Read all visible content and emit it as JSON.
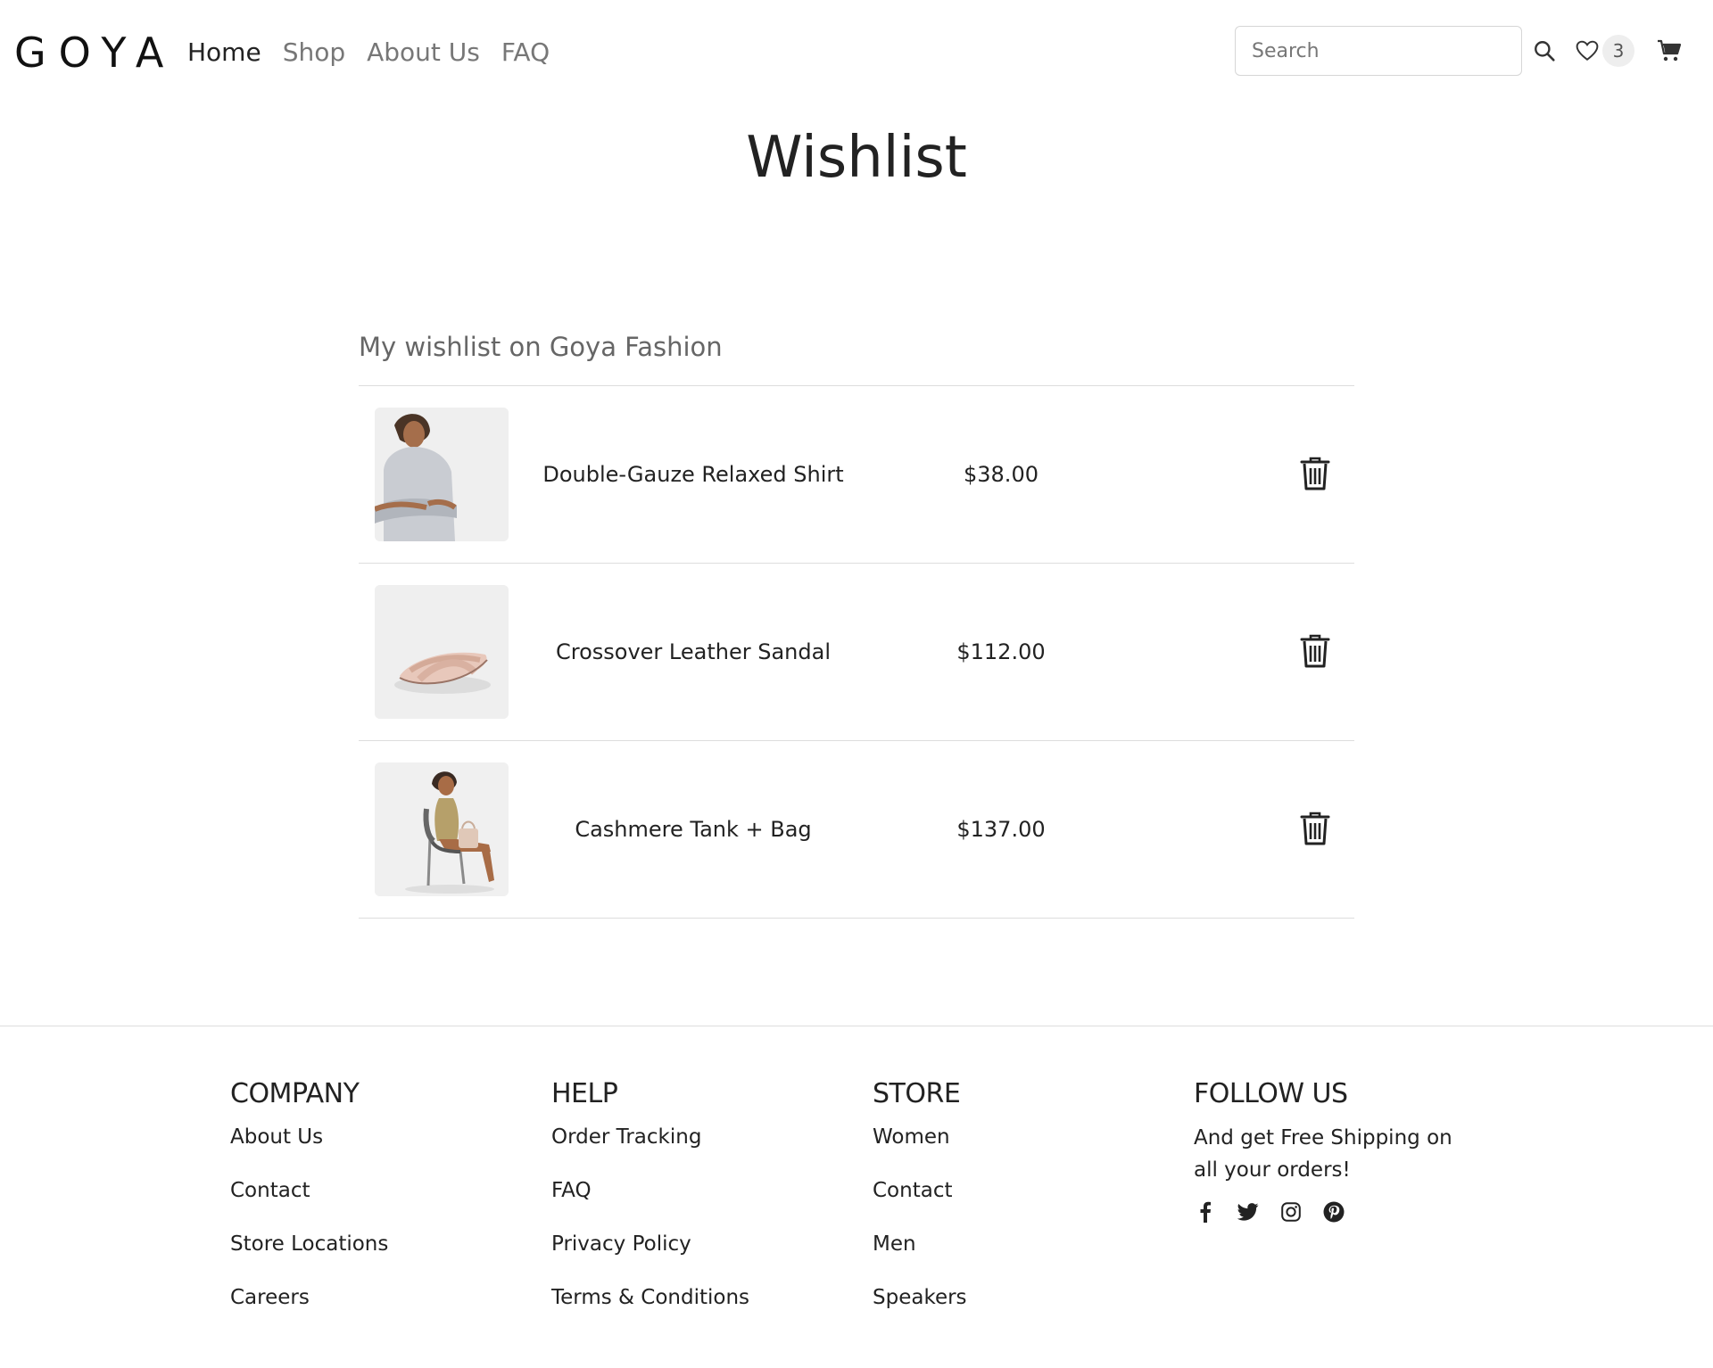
{
  "header": {
    "logo": "GOYA",
    "nav": [
      {
        "label": "Home",
        "active": true
      },
      {
        "label": "Shop",
        "active": false
      },
      {
        "label": "About Us",
        "active": false
      },
      {
        "label": "FAQ",
        "active": false
      }
    ],
    "search_placeholder": "Search",
    "wishlist_count": "3",
    "icons": [
      "search-icon",
      "heart-icon",
      "cart-icon"
    ]
  },
  "page": {
    "title": "Wishlist"
  },
  "wishlist": {
    "heading": "My wishlist on Goya Fashion",
    "items": [
      {
        "name": "Double-Gauze Relaxed Shirt",
        "price": "$38.00",
        "image": "shirt-photo"
      },
      {
        "name": "Crossover Leather Sandal",
        "price": "$112.00",
        "image": "sandal-photo"
      },
      {
        "name": "Cashmere Tank + Bag",
        "price": "$137.00",
        "image": "tank-bag-photo"
      }
    ]
  },
  "footer": {
    "company": {
      "title": "COMPANY",
      "links": [
        "About Us",
        "Contact",
        "Store Locations",
        "Careers"
      ]
    },
    "help": {
      "title": "HELP",
      "links": [
        "Order Tracking",
        "FAQ",
        "Privacy Policy",
        "Terms & Conditions"
      ]
    },
    "store": {
      "title": "STORE",
      "links": [
        "Women",
        "Contact",
        "Men",
        "Speakers"
      ]
    },
    "follow": {
      "title": "FOLLOW US",
      "text": "And get Free Shipping on all your orders!",
      "social": [
        "facebook-icon",
        "twitter-icon",
        "instagram-icon",
        "pinterest-icon"
      ]
    }
  },
  "colors": {
    "text": "#222222",
    "muted": "#777777",
    "border": "#dddddd",
    "badge_bg": "#eeeeee"
  }
}
